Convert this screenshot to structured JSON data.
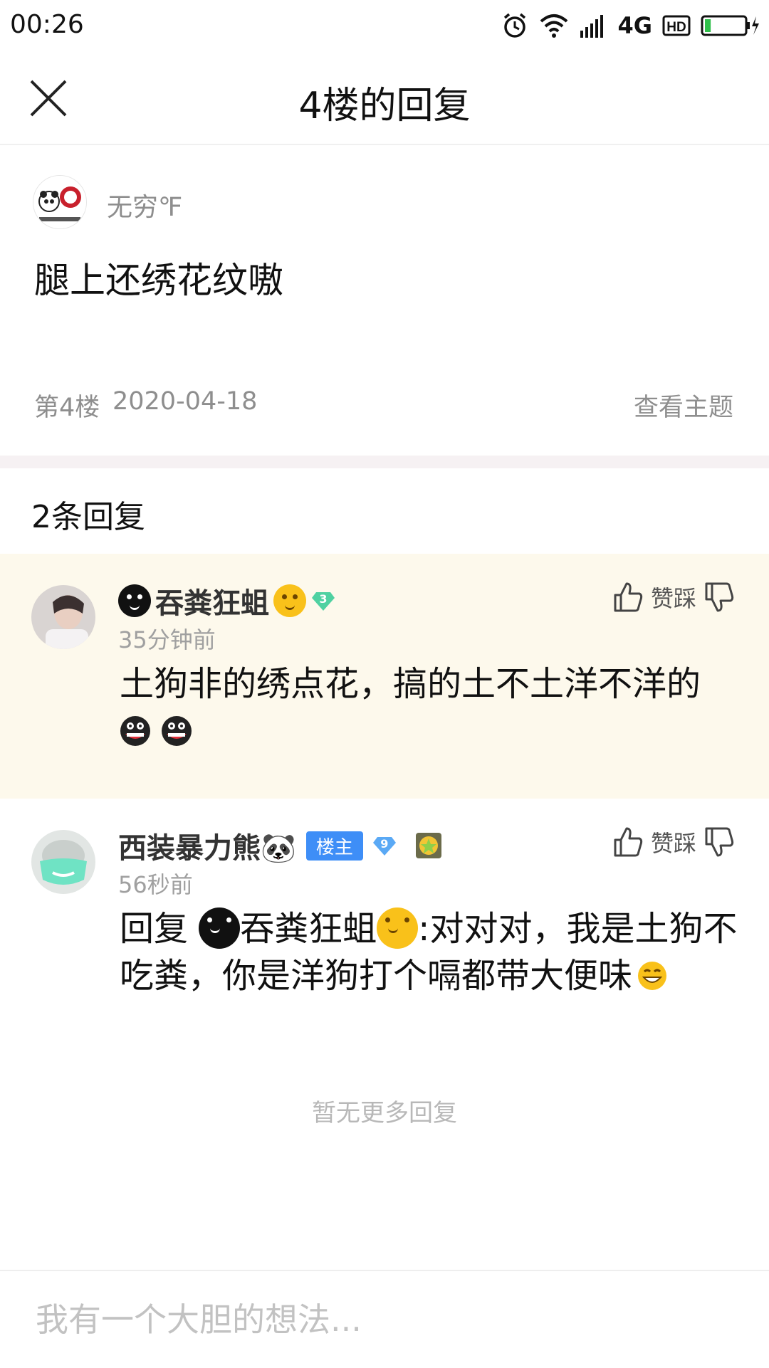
{
  "status_bar": {
    "time": "00:26",
    "network": "4G",
    "hd": "HD",
    "battery_level": 0.15
  },
  "header": {
    "title": "4楼的回复",
    "close_icon": "close-icon"
  },
  "post": {
    "author": "无穷℉",
    "content": "腿上还绣花纹嗷",
    "floor": "第4楼",
    "date": "2020-04-18",
    "view_topic": "查看主题"
  },
  "replies_section": {
    "count_label": "2条回复"
  },
  "replies": [
    {
      "author": "吞粪狂蛆",
      "level": "3",
      "time": "35分钟前",
      "vote_label": "赞踩",
      "content": "土狗非的绣点花，搞的土不土洋不洋的",
      "highlight_color": "#fdf9ec"
    },
    {
      "author": "西装暴力熊🐼",
      "host_badge": "楼主",
      "level": "9",
      "time": "56秒前",
      "vote_label": "赞踩",
      "reply_prefix": "回复",
      "reply_to": "吞粪狂蛆",
      "content": ":对对对，我是土狗不吃粪，你是洋狗打个嗝都带大便味"
    }
  ],
  "footer": {
    "no_more": "暂无更多回复"
  },
  "input": {
    "placeholder": "我有一个大胆的想法..."
  },
  "colors": {
    "accent_blue": "#3e8ef7",
    "level_badge_green": "#4fd1a1",
    "level_badge_blue": "#5aa9f5",
    "emoji_yellow": "#f9c11a"
  }
}
